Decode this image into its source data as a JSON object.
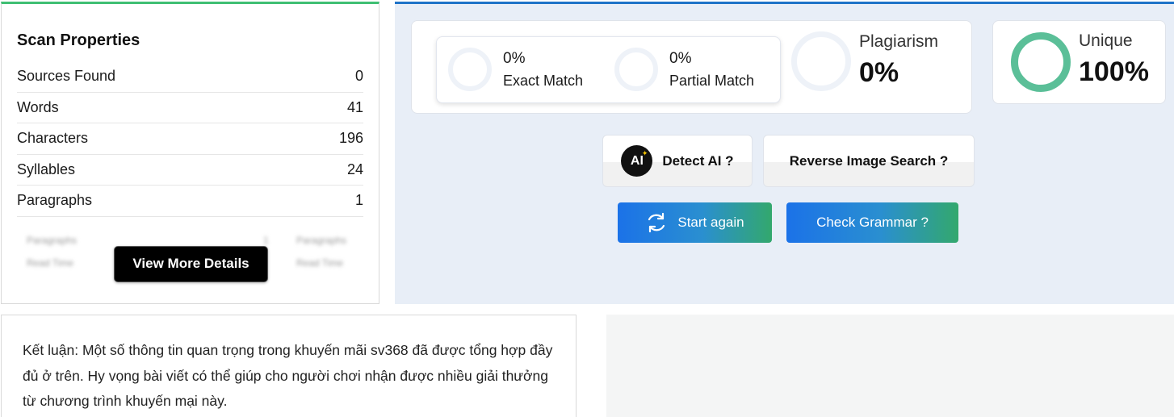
{
  "scan_properties": {
    "title": "Scan Properties",
    "rows": [
      {
        "label": "Sources Found",
        "value": "0"
      },
      {
        "label": "Words",
        "value": "41"
      },
      {
        "label": "Characters",
        "value": "196"
      },
      {
        "label": "Syllables",
        "value": "24"
      },
      {
        "label": "Paragraphs",
        "value": "1"
      }
    ],
    "blurred": {
      "left_top_label": "Paragraphs",
      "left_top_value": "1",
      "left_bottom_label": "Read Time",
      "right_top_label": "Paragraphs",
      "right_bottom_label": "Read Time"
    },
    "view_more_label": "View More Details"
  },
  "results": {
    "exact_match": {
      "percent": "0%",
      "label": "Exact Match"
    },
    "partial_match": {
      "percent": "0%",
      "label": "Partial Match"
    },
    "plagiarism": {
      "label": "Plagiarism",
      "value": "0%"
    },
    "unique": {
      "label": "Unique",
      "value": "100%"
    }
  },
  "tools": {
    "detect_ai_icon": "AI",
    "detect_ai_label": "Detect AI ?",
    "reverse_image_label": "Reverse Image Search ?",
    "start_again_label": "Start again",
    "check_grammar_label": "Check Grammar ?"
  },
  "conclusion": {
    "text": "Kết luận: Một số thông tin quan trọng trong khuyến mãi sv368 đã được tổng hợp đầy đủ ở trên. Hy vọng bài viết có thể giúp cho người chơi nhận được nhiều giải thưởng từ chương trình khuyến mại này."
  },
  "colors": {
    "accent_green": "#3fbf73",
    "accent_blue": "#1e73c8",
    "unique_ring": "#5bbf98",
    "button_gradient_start": "#1b72e8",
    "button_gradient_end": "#33a86d"
  },
  "icons": {
    "refresh": "refresh-icon",
    "ai": "ai-badge-icon"
  }
}
